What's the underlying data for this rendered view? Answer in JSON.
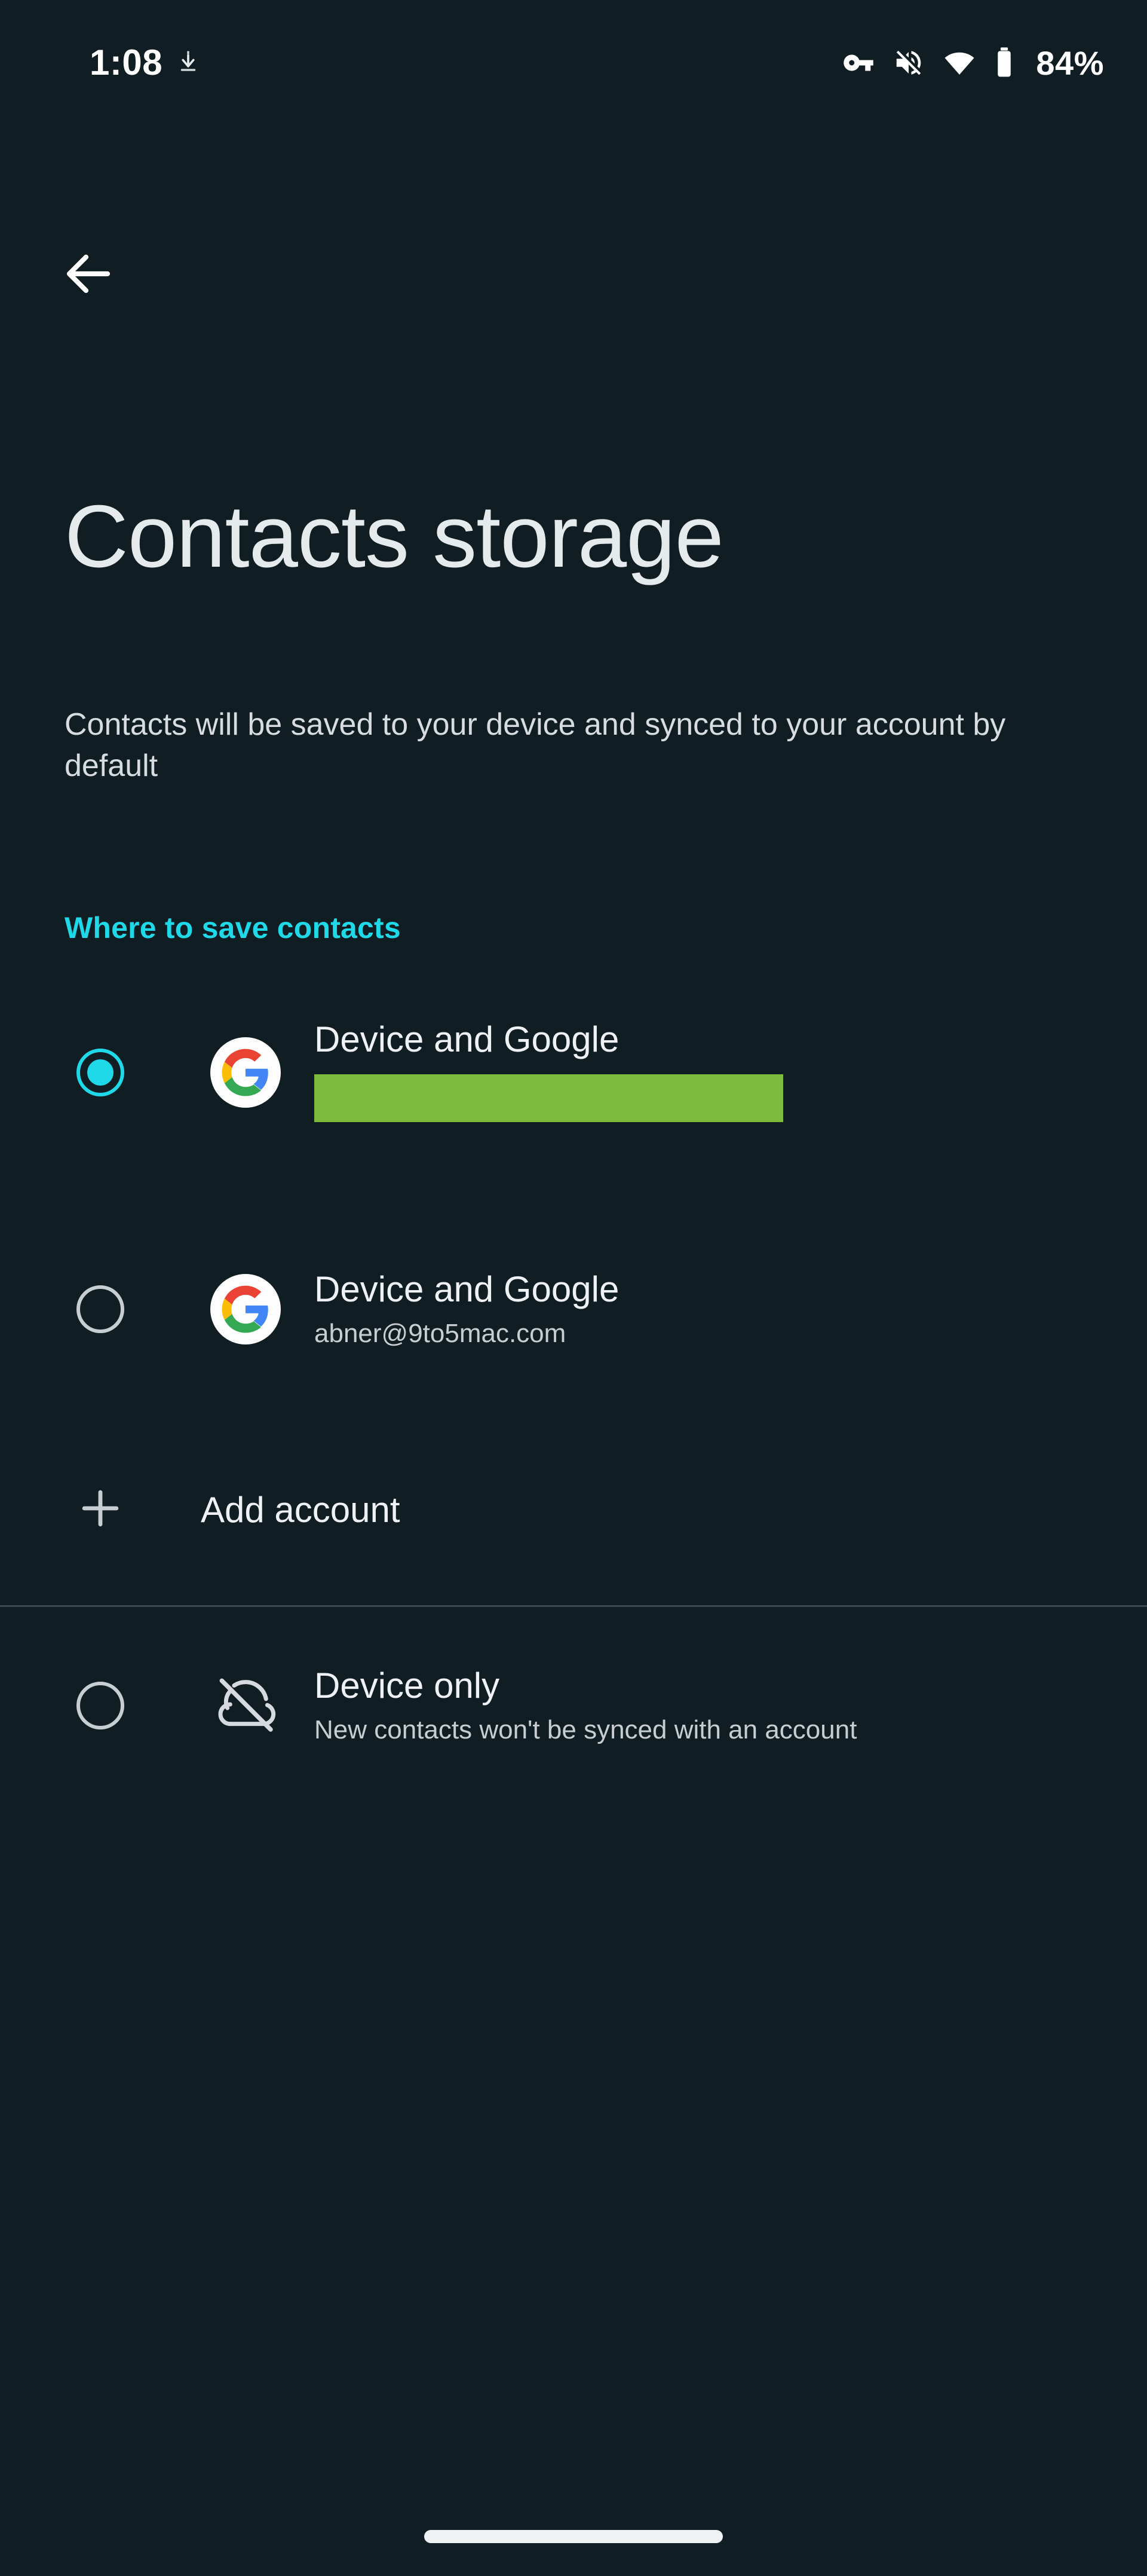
{
  "status_bar": {
    "time": "1:08",
    "download_icon": "download-icon",
    "vpn_key_icon": "vpn-key-icon",
    "volume_off_icon": "volume-off-icon",
    "wifi_icon": "wifi-icon",
    "battery_icon": "battery-icon",
    "battery_percent": "84%"
  },
  "nav": {
    "back_icon": "back-arrow-icon"
  },
  "header": {
    "title": "Contacts storage",
    "description": "Contacts will be saved to your device and synced to your account by default"
  },
  "section": {
    "label": "Where to save contacts"
  },
  "options": [
    {
      "id": "google-primary",
      "icon": "google-logo-icon",
      "title": "Device and Google",
      "subtitle": "",
      "selected": true,
      "redacted": true,
      "redaction_color": "#7cbb3c"
    },
    {
      "id": "google-secondary",
      "icon": "google-logo-icon",
      "title": "Device and Google",
      "subtitle": "abner@9to5mac.com",
      "selected": false,
      "redacted": false
    },
    {
      "id": "device-only",
      "icon": "cloud-off-icon",
      "title": "Device only",
      "subtitle": "New contacts won't be synced with an account",
      "selected": false,
      "redacted": false
    }
  ],
  "add_account": {
    "icon": "plus-icon",
    "label": "Add account"
  },
  "system": {
    "home_indicator": "home-indicator"
  },
  "colors": {
    "background": "#101d22",
    "accent": "#1fd8e8",
    "primary_text": "#eef2f4",
    "secondary_text": "#c7ced2",
    "divider": "#3b484d"
  }
}
